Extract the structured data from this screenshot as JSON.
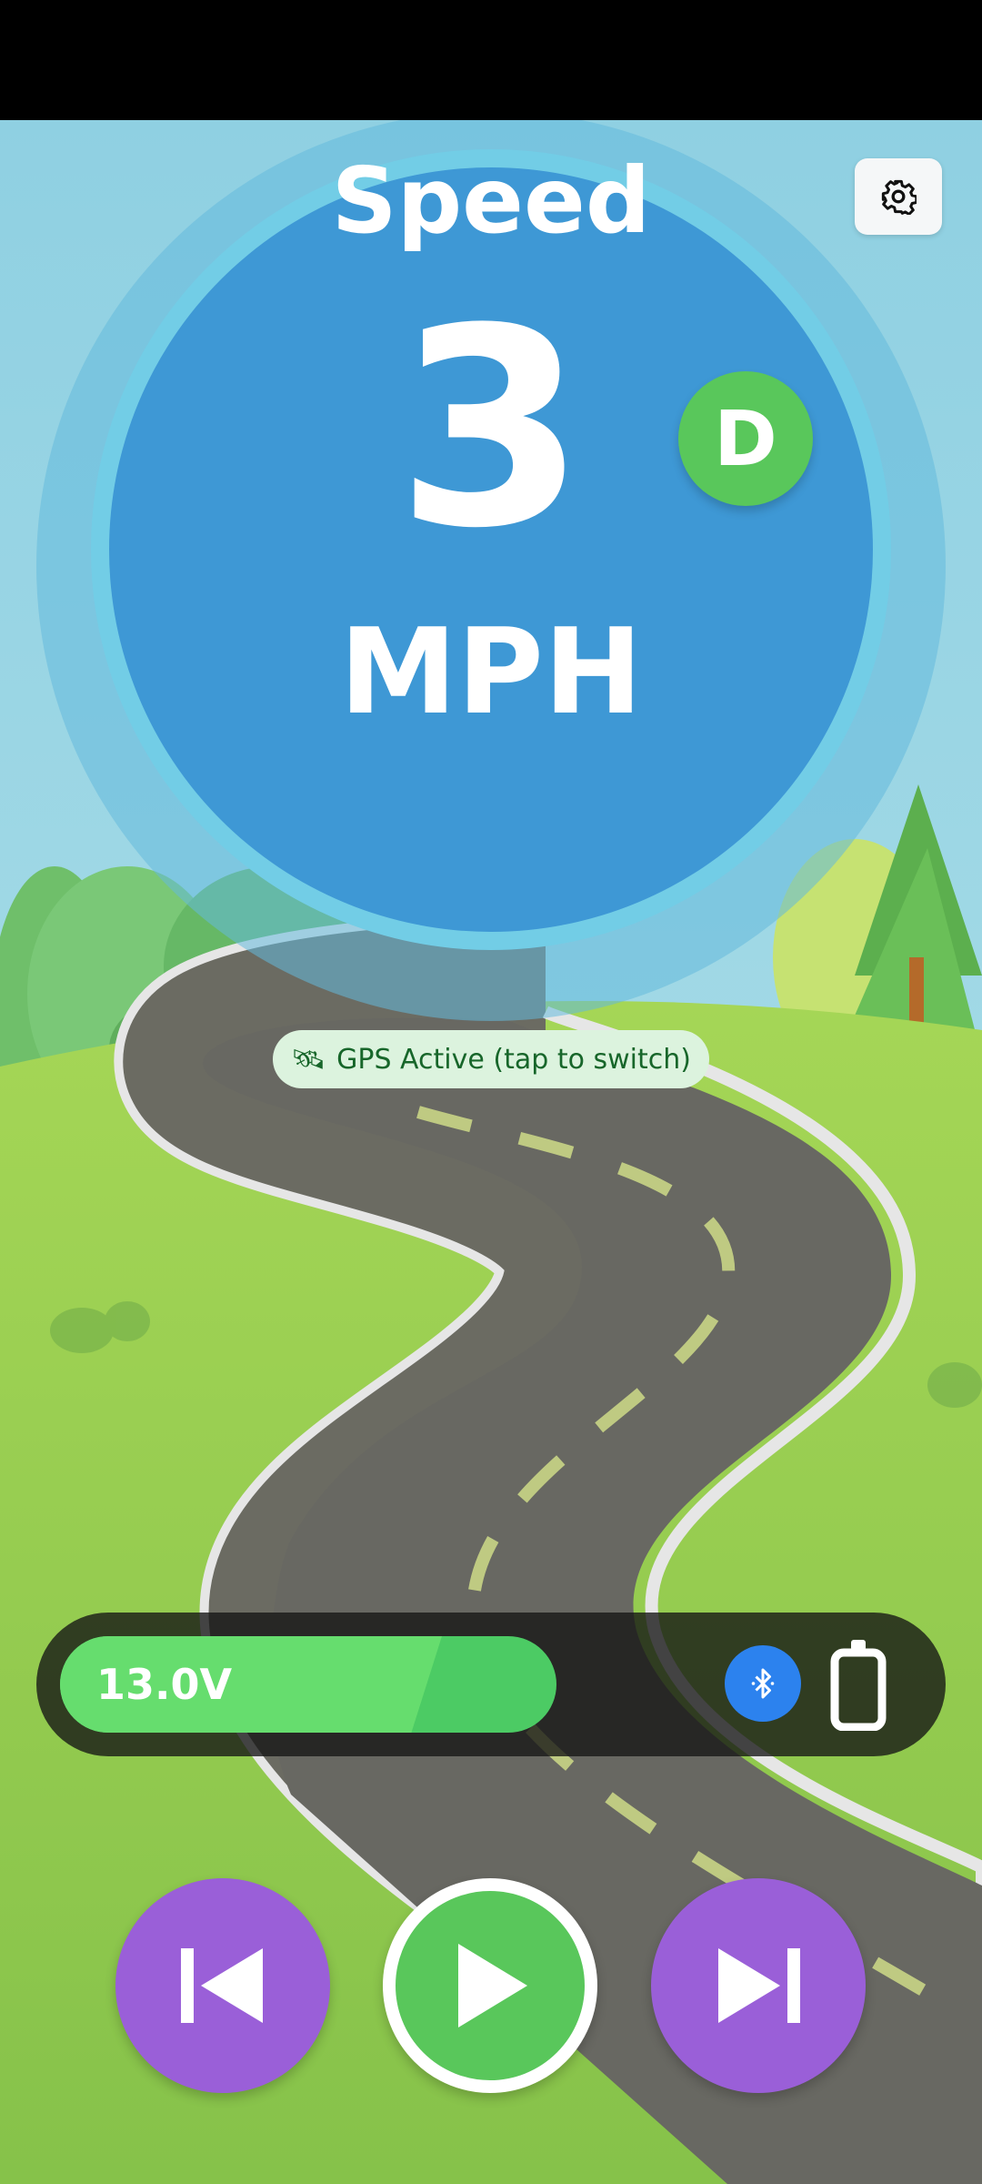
{
  "speedometer": {
    "title": "Speed",
    "value": "3",
    "unit": "MPH",
    "gear": "D"
  },
  "settings": {
    "icon": "gear-icon"
  },
  "gps": {
    "icon": "satellite-icon",
    "label": "GPS Active (tap to switch)"
  },
  "status_panel": {
    "battery_voltage": "13.0V",
    "bluetooth_icon": "bluetooth-icon",
    "phone_battery_icon": "battery-icon"
  },
  "media_controls": {
    "previous_icon": "skip-previous-icon",
    "play_icon": "play-icon",
    "next_icon": "skip-next-icon"
  },
  "colors": {
    "speed_disc": "#3e98d5",
    "gear_badge": "#59c75b",
    "media_buttons": "#9a5fd8",
    "play_button": "#59c75b",
    "bluetooth": "#2c82ee"
  }
}
